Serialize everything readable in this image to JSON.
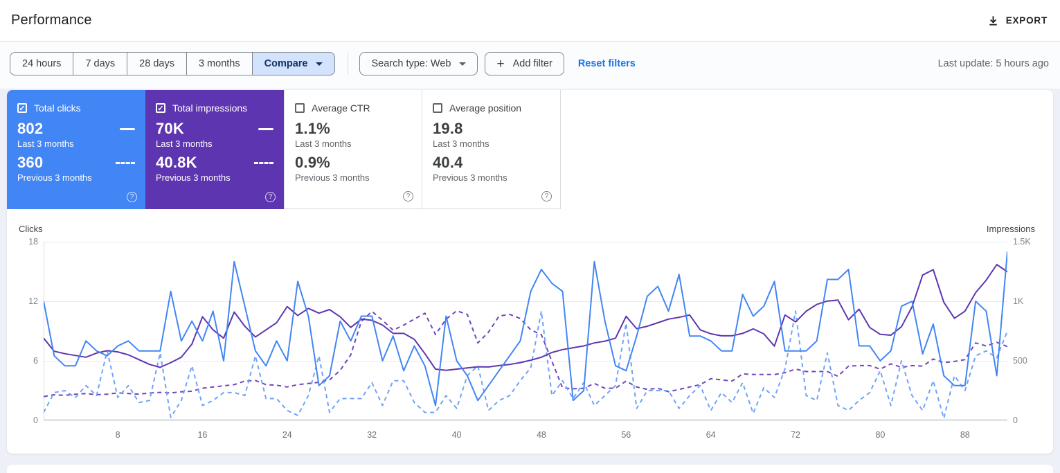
{
  "header": {
    "title": "Performance",
    "export_label": "EXPORT"
  },
  "filters": {
    "date_ranges": [
      {
        "label": "24 hours"
      },
      {
        "label": "7 days"
      },
      {
        "label": "28 days"
      },
      {
        "label": "3 months"
      }
    ],
    "compare_label": "Compare",
    "search_type_label": "Search type: Web",
    "add_filter_label": "Add filter",
    "reset_label": "Reset filters",
    "last_update": "Last update: 5 hours ago"
  },
  "cards": [
    {
      "label": "Total clicks",
      "checked": true,
      "color": "#4285f4",
      "value1": "802",
      "caption1": "Last 3 months",
      "value2": "360",
      "caption2": "Previous 3 months"
    },
    {
      "label": "Total impressions",
      "checked": true,
      "color": "#5e35b1",
      "value1": "70K",
      "caption1": "Last 3 months",
      "value2": "40.8K",
      "caption2": "Previous 3 months"
    },
    {
      "label": "Average CTR",
      "checked": false,
      "color": "#ffffff",
      "value1": "1.1%",
      "caption1": "Last 3 months",
      "value2": "0.9%",
      "caption2": "Previous 3 months"
    },
    {
      "label": "Average position",
      "checked": false,
      "color": "#ffffff",
      "value1": "19.8",
      "caption1": "Last 3 months",
      "value2": "40.4",
      "caption2": "Previous 3 months"
    }
  ],
  "chart_data": {
    "type": "line",
    "x_is_day_index": true,
    "x": [
      1,
      92
    ],
    "xticks": [
      8,
      16,
      24,
      32,
      40,
      48,
      56,
      64,
      72,
      80,
      88
    ],
    "left_axis": {
      "label": "Clicks",
      "ticks": [
        "18",
        "12",
        "6",
        "0"
      ],
      "range": [
        0,
        18
      ]
    },
    "right_axis": {
      "label": "Impressions",
      "ticks": [
        "1.5K",
        "1K",
        "500",
        "0"
      ],
      "range": [
        0,
        1500
      ]
    },
    "grid": "horizontal",
    "series": [
      {
        "name": "Clicks - Last 3 months",
        "axis": "left",
        "color": "#4285f4",
        "dashed": false,
        "values": [
          12,
          6.5,
          5.5,
          5.5,
          8,
          7,
          6.5,
          7.5,
          8,
          7,
          7,
          7,
          13,
          8,
          10,
          8,
          11,
          6,
          16,
          11.5,
          7,
          5.5,
          8,
          6,
          14,
          10.5,
          3.5,
          4.5,
          10,
          8,
          10.5,
          10.5,
          6,
          8.5,
          5,
          7.5,
          5.5,
          1.5,
          10.5,
          6,
          4.5,
          2,
          3.5,
          5,
          6.5,
          8,
          13,
          15.2,
          13.8,
          13,
          2,
          3,
          16,
          10,
          5.5,
          5,
          8.5,
          12.5,
          13.5,
          11,
          14.7,
          8.5,
          8.5,
          8,
          7,
          7,
          12.7,
          10.5,
          11.5,
          14,
          7,
          7,
          7,
          8,
          14.2,
          14.2,
          15.2,
          7.5,
          7.5,
          6,
          7,
          11.5,
          12,
          6.7,
          9.7,
          4.5,
          3.5,
          3.5,
          12,
          11,
          4.5,
          17
        ]
      },
      {
        "name": "Clicks - Previous 3 months",
        "axis": "left",
        "color": "#6fa2f8",
        "dashed": true,
        "values": [
          0.8,
          2.8,
          3,
          2.3,
          3.5,
          2.5,
          7,
          2.3,
          3.5,
          1.8,
          2,
          6.8,
          0.3,
          2,
          5.5,
          1.5,
          2,
          2.8,
          2.8,
          2.5,
          6.5,
          2.2,
          2.2,
          1,
          0.5,
          2.5,
          6.5,
          0.8,
          2.2,
          2.2,
          2.2,
          3.8,
          1.5,
          4,
          4,
          1.8,
          0.8,
          0.8,
          2.5,
          1.2,
          4.5,
          5.5,
          1,
          2,
          2.5,
          4,
          5.3,
          11,
          2.5,
          4,
          2.2,
          3.8,
          1.5,
          2.5,
          3.5,
          9.8,
          1.2,
          3,
          3,
          3,
          1.2,
          2.5,
          3.5,
          1,
          2.8,
          1.8,
          3.8,
          0.7,
          3.3,
          2.3,
          5.2,
          11,
          2.5,
          2,
          6.8,
          1.5,
          1,
          2,
          2.8,
          5,
          1.5,
          6,
          2.5,
          1,
          4,
          0.2,
          4.5,
          3,
          6.5,
          7,
          6.3,
          9
        ]
      },
      {
        "name": "Impressions - Last 3 months",
        "axis": "right",
        "color": "#5e35b1",
        "dashed": false,
        "values": [
          690,
          580,
          560,
          545,
          530,
          565,
          585,
          575,
          550,
          510,
          470,
          445,
          485,
          530,
          640,
          870,
          760,
          690,
          910,
          790,
          700,
          760,
          820,
          955,
          880,
          940,
          900,
          930,
          870,
          780,
          850,
          840,
          800,
          730,
          730,
          680,
          560,
          430,
          420,
          430,
          440,
          450,
          448,
          460,
          470,
          485,
          505,
          530,
          570,
          594,
          610,
          625,
          650,
          665,
          690,
          873,
          770,
          790,
          820,
          850,
          865,
          885,
          760,
          727,
          710,
          710,
          730,
          768,
          727,
          623,
          885,
          827,
          916,
          973,
          1002,
          1010,
          845,
          933,
          780,
          722,
          715,
          786,
          953,
          1220,
          1265,
          992,
          857,
          917,
          1072,
          1177,
          1308,
          1247
        ]
      },
      {
        "name": "Impressions - Previous 3 months",
        "axis": "right",
        "color": "#6e45bd",
        "dashed": true,
        "values": [
          200,
          215,
          210,
          220,
          225,
          215,
          220,
          230,
          225,
          220,
          230,
          235,
          230,
          240,
          245,
          270,
          280,
          290,
          300,
          330,
          335,
          300,
          295,
          280,
          300,
          310,
          320,
          340,
          420,
          550,
          830,
          915,
          840,
          757,
          800,
          850,
          900,
          720,
          850,
          920,
          890,
          650,
          740,
          875,
          890,
          855,
          760,
          720,
          495,
          273,
          265,
          270,
          310,
          270,
          270,
          330,
          280,
          260,
          270,
          240,
          260,
          280,
          300,
          350,
          340,
          330,
          390,
          385,
          385,
          385,
          400,
          430,
          410,
          410,
          410,
          370,
          455,
          460,
          460,
          430,
          475,
          445,
          460,
          455,
          515,
          485,
          495,
          510,
          650,
          625,
          655,
          620
        ]
      }
    ]
  }
}
